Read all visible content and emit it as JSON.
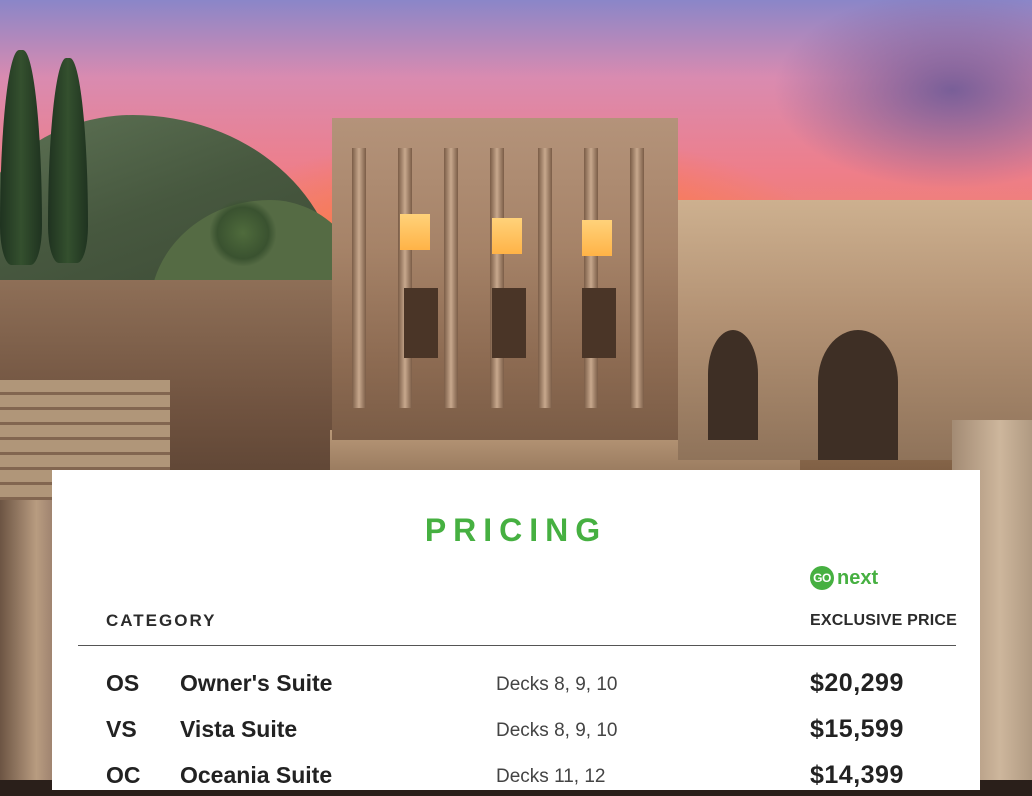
{
  "pricing": {
    "title": "PRICING",
    "brand": {
      "badge": "GO",
      "word": "next"
    },
    "header": {
      "category": "CATEGORY",
      "price": "EXCLUSIVE PRICE"
    },
    "rows": [
      {
        "code": "OS",
        "name": "Owner's Suite",
        "decks": "Decks 8, 9, 10",
        "price": "$20,299"
      },
      {
        "code": "VS",
        "name": "Vista Suite",
        "decks": "Decks 8, 9, 10",
        "price": "$15,599"
      },
      {
        "code": "OC",
        "name": "Oceania Suite",
        "decks": "Decks 11, 12",
        "price": "$14,399"
      }
    ]
  },
  "colors": {
    "accent": "#46b041",
    "text": "#222222"
  }
}
